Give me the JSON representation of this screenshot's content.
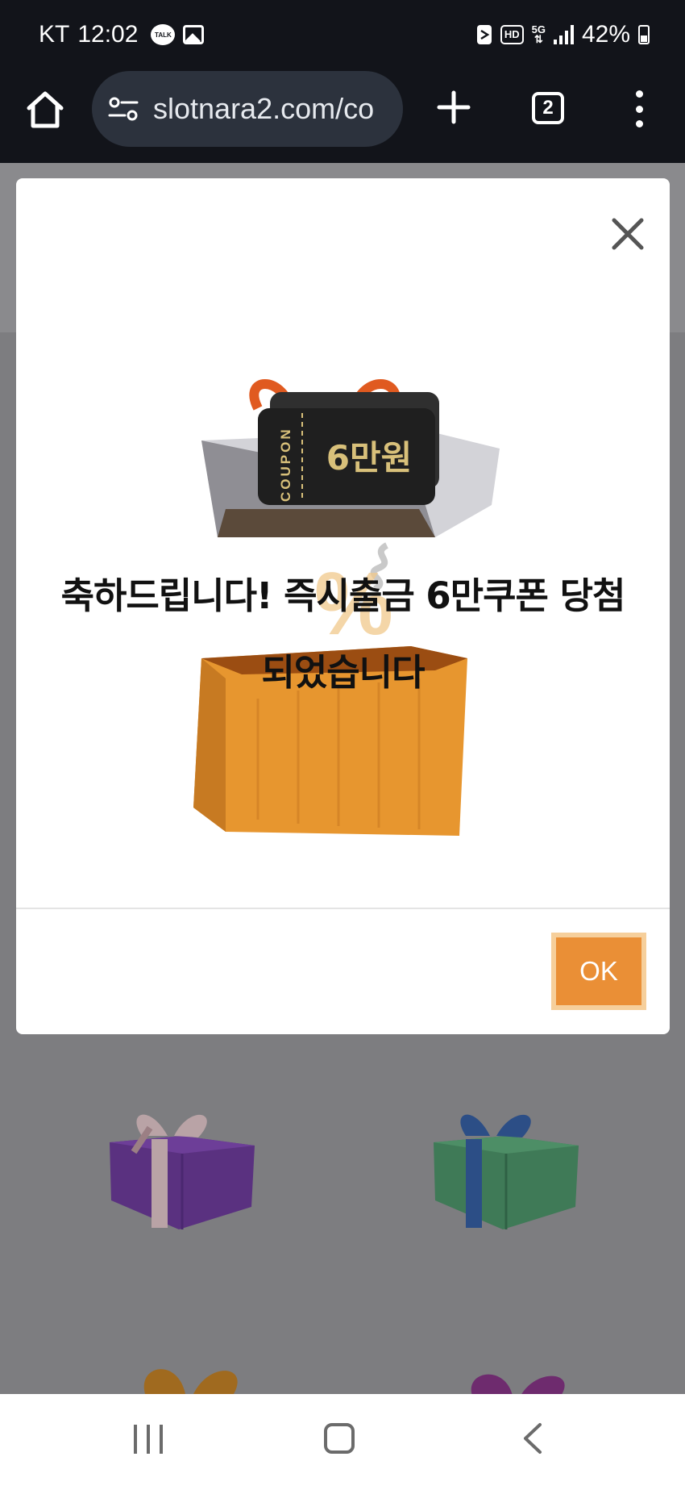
{
  "status_bar": {
    "carrier": "KT",
    "time": "12:02",
    "talk_badge": "TALK",
    "hd_badge": "HD",
    "network": "5G",
    "battery": "42%",
    "battery_level": 0.42,
    "icons": [
      "kakaotalk-icon",
      "gallery-icon",
      "nfc-icon",
      "hd-voice-icon",
      "5g-icon",
      "signal-icon",
      "battery-icon"
    ]
  },
  "browser": {
    "url": "slotnara2.com/co",
    "tab_count": "2",
    "icons": [
      "home-icon",
      "site-settings-icon",
      "plus-icon",
      "tabs-icon",
      "more-vert-icon"
    ]
  },
  "modal": {
    "message_line1": "축하드립니다! 즉시출금 6만쿠폰 당첨",
    "message_line2": "되었습니다",
    "ok_label": "OK",
    "coupon": {
      "side_text": "COUPON",
      "amount": "6만원"
    }
  },
  "colors": {
    "accent": "#ea8f36",
    "accent_border": "#f6cf9b",
    "dark_bar": "#12141a",
    "overlay": "#7d7d80"
  },
  "navigation_bar": {
    "icons": [
      "recent-apps-icon",
      "home-icon",
      "back-icon"
    ]
  }
}
